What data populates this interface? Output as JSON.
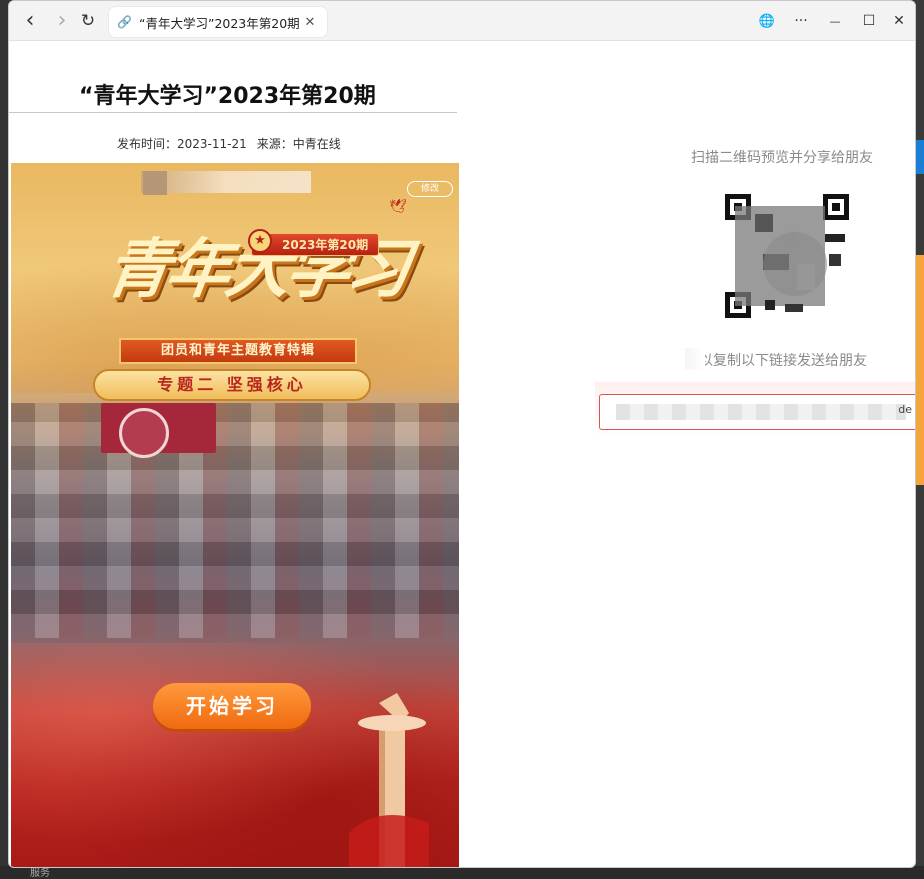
{
  "browser": {
    "tab_title": "“青年大学习”2023年第20期",
    "back_icon": "back-arrow-icon",
    "forward_icon": "forward-arrow-icon",
    "reload_icon": "reload-icon",
    "globe_icon": "globe-icon",
    "more_icon": "more-icon",
    "back_glyph": "‹",
    "forward_glyph": "›",
    "reload_glyph": "↻",
    "link_glyph": "🔗",
    "close_glyph": "✕",
    "globe_glyph": "🌐",
    "more_glyph": "···",
    "minimize_glyph": "—",
    "maximize_glyph": "☐",
    "window_close_glyph": "✕"
  },
  "article": {
    "title": "“青年大学习”2023年第20期",
    "publish_label": "发布时间：2023-11-21",
    "source_label": "来源：中青在线"
  },
  "poster": {
    "edit_chip": "修改",
    "issue_badge": "2023年第20期",
    "star_glyph": "★",
    "logo_text": "青年大学习",
    "subtitle": "团员和青年主题教育特辑",
    "topic": "专题二  坚强核心",
    "start_button": "开始学习",
    "bird_glyph": "🕊"
  },
  "share": {
    "scan_label": "扫描二维码预览并分享给朋友",
    "copy_label": "可以复制以下链接发送给朋友",
    "link_tail": "de"
  },
  "desktop": {
    "bottom_label": "服务"
  }
}
